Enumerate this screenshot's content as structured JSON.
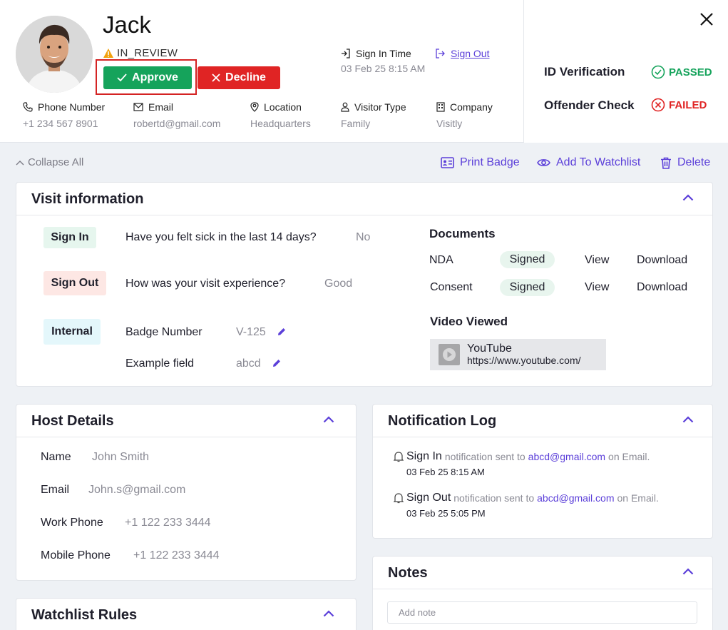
{
  "visitor": {
    "name": "Jack",
    "status": "IN_REVIEW",
    "approve_label": "Approve",
    "decline_label": "Decline",
    "sign_in_time_label": "Sign In Time",
    "sign_in_time_value": "03 Feb 25 8:15 AM",
    "sign_out_label": "Sign Out",
    "fields": [
      {
        "label": "Phone Number",
        "value": "+1 234 567 8901",
        "icon": "phone-icon"
      },
      {
        "label": "Email",
        "value": "robertd@gmail.com",
        "icon": "mail-icon"
      },
      {
        "label": "Location",
        "value": "Headquarters",
        "icon": "location-pin-icon"
      },
      {
        "label": "Visitor Type",
        "value": "Family",
        "icon": "person-icon"
      },
      {
        "label": "Company",
        "value": "Visitly",
        "icon": "building-icon"
      }
    ]
  },
  "checks": [
    {
      "label": "ID Verification",
      "result": "PASSED"
    },
    {
      "label": "Offender Check",
      "result": "FAILED"
    }
  ],
  "toolbar": {
    "collapse_all": "Collapse All",
    "print_badge": "Print Badge",
    "add_to_watchlist": "Add To Watchlist",
    "delete": "Delete"
  },
  "visit_info": {
    "title": "Visit information",
    "rows": [
      {
        "tag": "Sign In",
        "question": "Have you felt sick in the last 14 days?",
        "answer": "No"
      },
      {
        "tag": "Sign Out",
        "question": "How was your visit experience?",
        "answer": "Good"
      },
      {
        "tag": "Internal",
        "question": "Badge Number",
        "answer": "V-125"
      },
      {
        "tag": "",
        "question": "Example field",
        "answer": "abcd"
      }
    ],
    "documents_title": "Documents",
    "documents": [
      {
        "name": "NDA",
        "status": "Signed",
        "view": "View",
        "download": "Download"
      },
      {
        "name": "Consent",
        "status": "Signed",
        "view": "View",
        "download": "Download"
      }
    ],
    "video_title": "Video Viewed",
    "video_name": "YouTube",
    "video_url": "https://www.youtube.com/"
  },
  "host": {
    "title": "Host Details",
    "rows": [
      {
        "label": "Name",
        "value": "John Smith"
      },
      {
        "label": "Email",
        "value": "John.s@gmail.com"
      },
      {
        "label": "Work Phone",
        "value": "+1 122 233 3444"
      },
      {
        "label": "Mobile Phone",
        "value": "+1 122 233 3444"
      }
    ]
  },
  "notification_log": {
    "title": "Notification Log",
    "entries": [
      {
        "event": "Sign In",
        "text": "notification sent to",
        "email": "abcd@gmail.com",
        "channel": "on Email.",
        "time": "03 Feb 25 8:15 AM"
      },
      {
        "event": "Sign Out",
        "text": "notification sent to",
        "email": "abcd@gmail.com",
        "channel": "on Email.",
        "time": "03 Feb 25 5:05 PM"
      }
    ]
  },
  "watchlist": {
    "title": "Watchlist Rules"
  },
  "notes": {
    "title": "Notes",
    "placeholder": "Add note"
  },
  "colors": {
    "accent": "#5b3fd9",
    "approve": "#15a35b",
    "decline": "#e02424",
    "highlight": "#d42323"
  }
}
